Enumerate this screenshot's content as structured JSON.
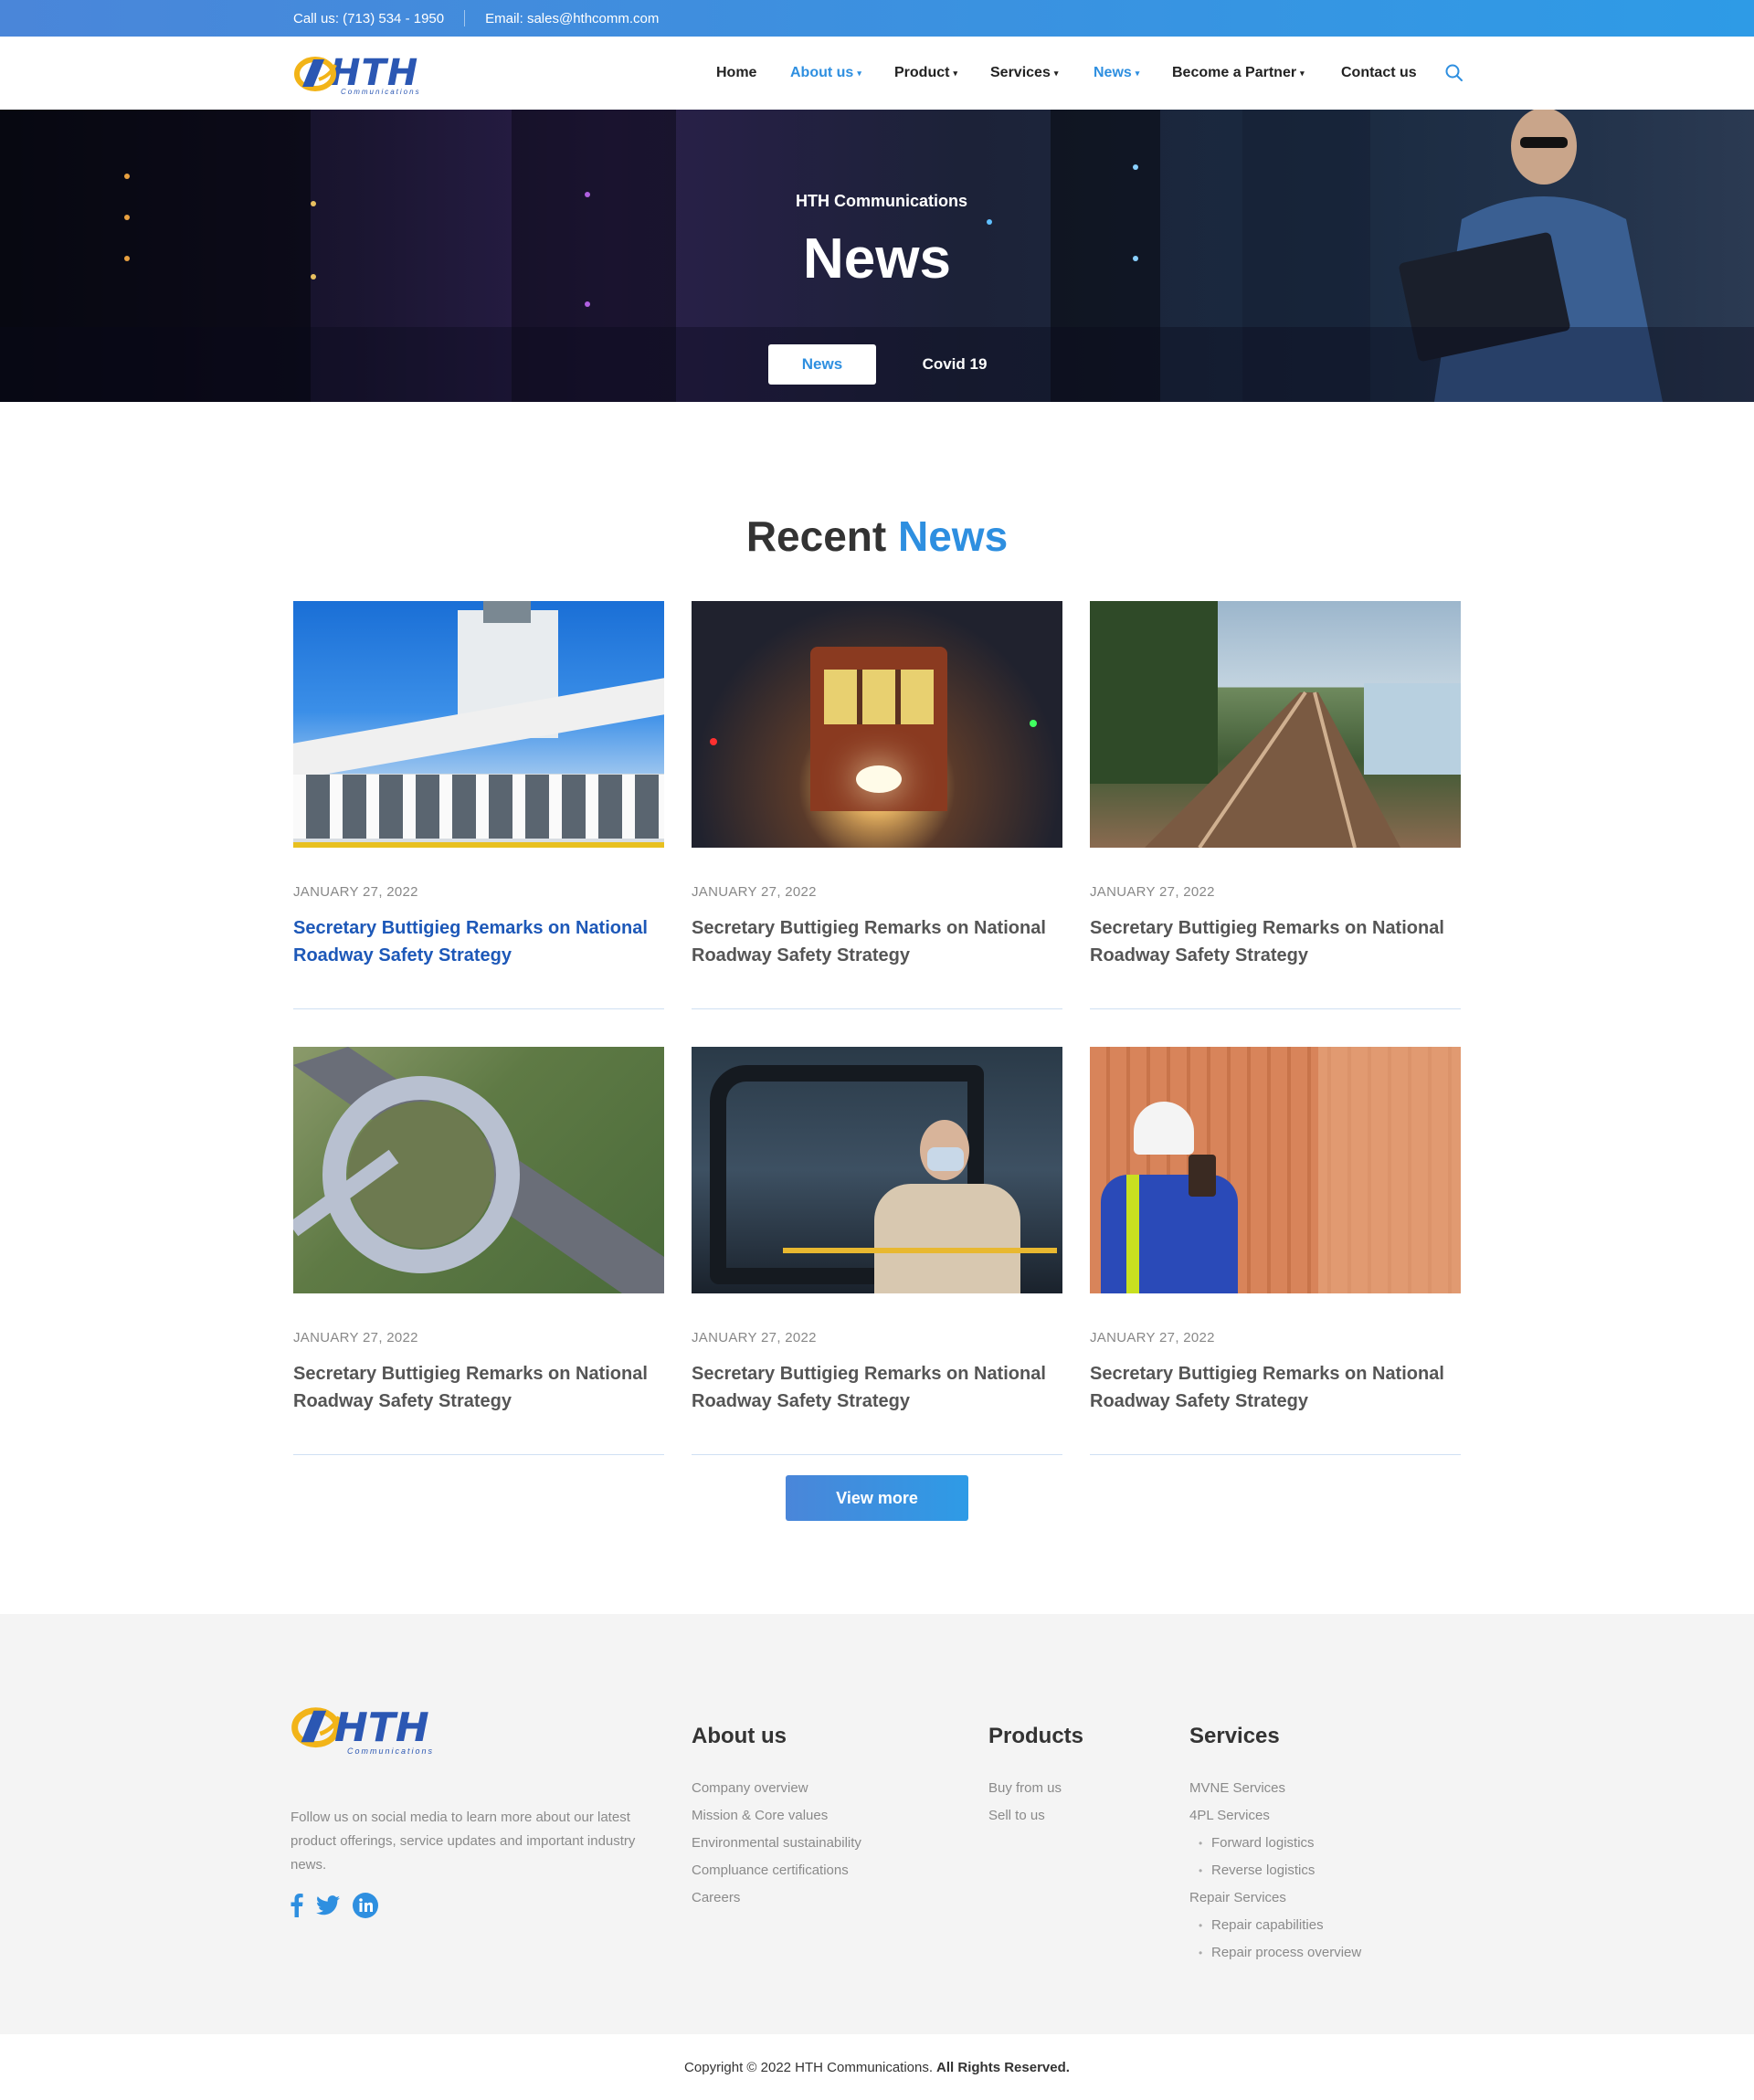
{
  "topbar": {
    "phone": "Call us: (713) 534 - 1950",
    "email": "Email: sales@hthcomm.com"
  },
  "brand": {
    "name": "HTH",
    "tagline": "Communications",
    "primary_color": "#2e8fe0",
    "logo_blue": "#2b57b3",
    "logo_yellow": "#f2b418"
  },
  "nav": {
    "items": [
      {
        "label": "Home"
      },
      {
        "label": "About us"
      },
      {
        "label": "Product"
      },
      {
        "label": "Services"
      },
      {
        "label": "News"
      },
      {
        "label": "Become a Partner"
      },
      {
        "label": "Contact us"
      }
    ]
  },
  "hero": {
    "subtitle": "HTH Communications",
    "title": "News",
    "tabs": [
      "News",
      "Covid 19"
    ]
  },
  "recent": {
    "title_part1": "Recent",
    "title_part2": "News",
    "cards": [
      {
        "date": "JANUARY 27, 2022",
        "title": "Secretary Buttigieg Remarks on National Roadway Safety Strategy"
      },
      {
        "date": "JANUARY 27, 2022",
        "title": "Secretary Buttigieg Remarks on National Roadway Safety Strategy"
      },
      {
        "date": "JANUARY 27, 2022",
        "title": "Secretary Buttigieg Remarks on National Roadway Safety Strategy"
      },
      {
        "date": "JANUARY 27, 2022",
        "title": "Secretary Buttigieg Remarks on National Roadway Safety Strategy"
      },
      {
        "date": "JANUARY 27, 2022",
        "title": "Secretary Buttigieg Remarks on National Roadway Safety Strategy"
      },
      {
        "date": "JANUARY 27, 2022",
        "title": "Secretary Buttigieg Remarks on National Roadway Safety Strategy"
      }
    ],
    "view_more": "View more"
  },
  "footer": {
    "about_text": "Follow us on social media to learn more about our latest product offerings, service updates and important industry news.",
    "social_icons": [
      "facebook-icon",
      "twitter-icon",
      "linkedin-icon"
    ],
    "about": {
      "heading": "About us",
      "links": [
        "Company overview",
        "Mission & Core values",
        "Environmental sustainability",
        "Compluance certifications",
        "Careers"
      ]
    },
    "products": {
      "heading": "Products",
      "links": [
        "Buy from us",
        "Sell to us"
      ]
    },
    "services": {
      "heading": "Services",
      "links": [
        "MVNE Services",
        "4PL Services",
        "Forward logistics",
        "Reverse logistics",
        "Repair Services",
        "Repair capabilities",
        "Repair process overview"
      ]
    }
  },
  "copyright": {
    "text": "Copyright © 2022 HTH Communications.",
    "bold": "All Rights Reserved."
  }
}
